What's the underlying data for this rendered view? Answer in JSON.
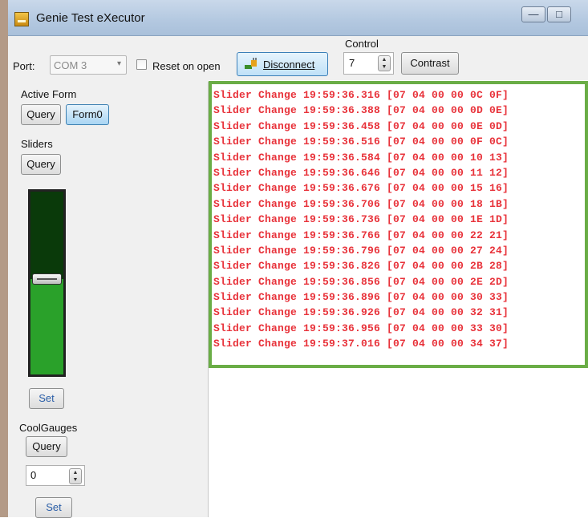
{
  "window": {
    "title": "Genie Test eXecutor",
    "minimize_glyph": "—",
    "maximize_glyph": "□"
  },
  "toolbar": {
    "port_label": "Port:",
    "port_value": "COM 3",
    "port_arrow": "▾",
    "reset_label": "Reset on open",
    "reset_checked": false,
    "disconnect_label": "Disconnect",
    "control_label": "Control",
    "control_value": "7",
    "spin_up": "▲",
    "spin_down": "▼",
    "contrast_label": "Contrast"
  },
  "sidebar": {
    "active_form": {
      "label": "Active Form",
      "query_label": "Query",
      "form_label": "Form0"
    },
    "sliders": {
      "label": "Sliders",
      "query_label": "Query",
      "slider_level": 0.52,
      "set_label": "Set"
    },
    "coolgauges": {
      "label": "CoolGauges",
      "query_label": "Query",
      "value": "0",
      "set_label": "Set"
    }
  },
  "log": {
    "lines": [
      "Slider Change 19:59:36.316 [07 04 00 00 0C 0F]",
      "Slider Change 19:59:36.388 [07 04 00 00 0D 0E]",
      "Slider Change 19:59:36.458 [07 04 00 00 0E 0D]",
      "Slider Change 19:59:36.516 [07 04 00 00 0F 0C]",
      "Slider Change 19:59:36.584 [07 04 00 00 10 13]",
      "Slider Change 19:59:36.646 [07 04 00 00 11 12]",
      "Slider Change 19:59:36.676 [07 04 00 00 15 16]",
      "Slider Change 19:59:36.706 [07 04 00 00 18 1B]",
      "Slider Change 19:59:36.736 [07 04 00 00 1E 1D]",
      "Slider Change 19:59:36.766 [07 04 00 00 22 21]",
      "Slider Change 19:59:36.796 [07 04 00 00 27 24]",
      "Slider Change 19:59:36.826 [07 04 00 00 2B 28]",
      "Slider Change 19:59:36.856 [07 04 00 00 2E 2D]",
      "Slider Change 19:59:36.896 [07 04 00 00 30 33]",
      "Slider Change 19:59:36.926 [07 04 00 00 32 31]",
      "Slider Change 19:59:36.956 [07 04 00 00 33 30]",
      "Slider Change 19:59:37.016 [07 04 00 00 34 37]"
    ]
  },
  "colors": {
    "log_text": "#e8323a",
    "highlight_border": "#6aad46",
    "slider_fill": "#2aa12a",
    "slider_empty": "#0a3a0a"
  }
}
